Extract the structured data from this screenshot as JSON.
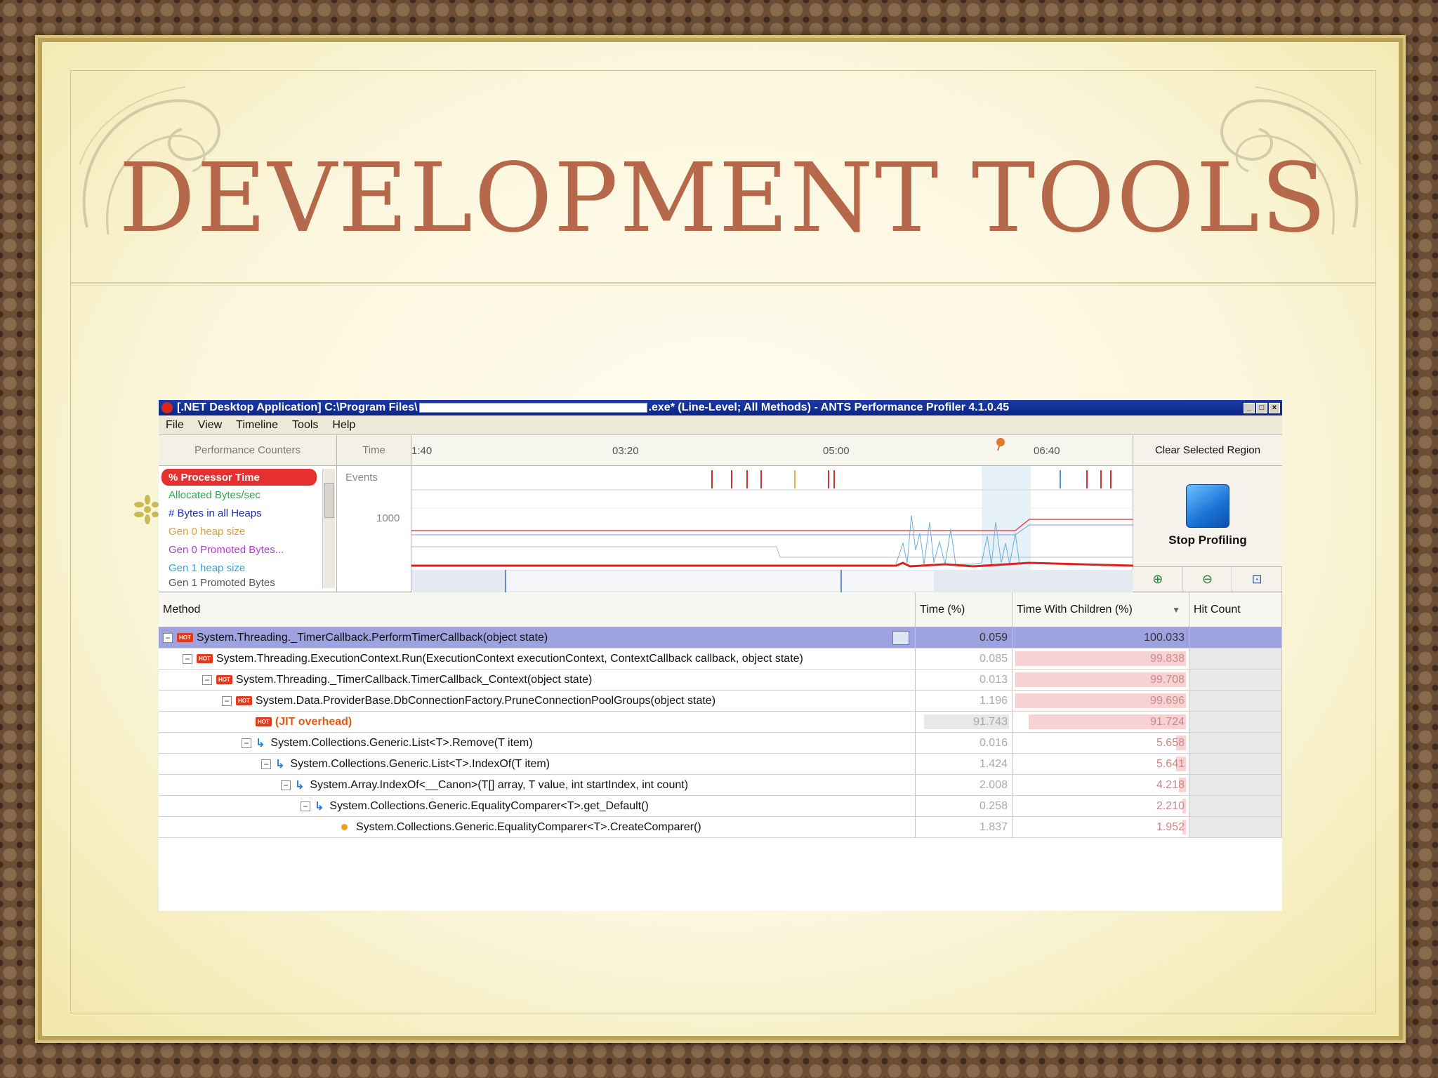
{
  "slide": {
    "title": "DEVELOPMENT TOOLS"
  },
  "window": {
    "title_prefix": "[.NET Desktop Application] C:\\Program Files\\",
    "title_suffix": ".exe* (Line-Level; All Methods) - ANTS Performance Profiler 4.1.0.45"
  },
  "menu": {
    "items": [
      "File",
      "View",
      "Timeline",
      "Tools",
      "Help"
    ]
  },
  "timeline": {
    "performance_counters_label": "Performance Counters",
    "time_label": "Time",
    "events_label": "Events",
    "y_tick": "1000",
    "ticks": [
      "1:40",
      "03:20",
      "05:00",
      "06:40"
    ],
    "clear_region_label": "Clear Selected Region",
    "stop_profiling_label": "Stop Profiling",
    "counters": [
      {
        "label": "% Processor Time",
        "color": "#ffffff"
      },
      {
        "label": "Allocated Bytes/sec",
        "color": "#2aa84a"
      },
      {
        "label": "# Bytes in all Heaps",
        "color": "#1c2fb3"
      },
      {
        "label": "Gen 0 heap size",
        "color": "#e0a030"
      },
      {
        "label": "Gen 0 Promoted Bytes...",
        "color": "#b33ad1"
      },
      {
        "label": "Gen 1 heap size",
        "color": "#30a8d8"
      },
      {
        "label": "Gen 1 Promoted Bytes",
        "color": "#555555"
      }
    ]
  },
  "grid": {
    "headers": {
      "method": "Method",
      "time": "Time (%)",
      "twc": "Time With Children (%)",
      "hits": "Hit Count"
    },
    "rows": [
      {
        "method": "System.Threading._TimerCallback.PerformTimerCallback(object state)",
        "time": "0.059",
        "twc": "100.033",
        "twc_pct": 100,
        "kind": "hot"
      },
      {
        "method": "System.Threading.ExecutionContext.Run(ExecutionContext executionContext, ContextCallback callback, object state)",
        "time": "0.085",
        "twc": "99.838",
        "twc_pct": 99.8,
        "kind": "hot"
      },
      {
        "method": "System.Threading._TimerCallback.TimerCallback_Context(object state)",
        "time": "0.013",
        "twc": "99.708",
        "twc_pct": 99.7,
        "kind": "hot"
      },
      {
        "method": "System.Data.ProviderBase.DbConnectionFactory.PruneConnectionPoolGroups(object state)",
        "time": "1.196",
        "twc": "99.696",
        "twc_pct": 99.7,
        "kind": "hot"
      },
      {
        "method": "(JIT overhead)",
        "time": "91.743",
        "twc": "91.724",
        "twc_pct": 91.7,
        "kind": "jit"
      },
      {
        "method": "System.Collections.Generic.List<T>.Remove(T item)",
        "time": "0.016",
        "twc": "5.658",
        "twc_pct": 5.7,
        "kind": "call"
      },
      {
        "method": "System.Collections.Generic.List<T>.IndexOf(T item)",
        "time": "1.424",
        "twc": "5.641",
        "twc_pct": 5.6,
        "kind": "call"
      },
      {
        "method": "System.Array.IndexOf<__Canon>(T[] array, T value, int startIndex, int count)",
        "time": "2.008",
        "twc": "4.218",
        "twc_pct": 4.2,
        "kind": "call"
      },
      {
        "method": "System.Collections.Generic.EqualityComparer<T>.get_Default()",
        "time": "0.258",
        "twc": "2.210",
        "twc_pct": 2.2,
        "kind": "call"
      },
      {
        "method": "System.Collections.Generic.EqualityComparer<T>.CreateComparer()",
        "time": "1.837",
        "twc": "1.952",
        "twc_pct": 1.95,
        "kind": "leaf"
      }
    ]
  }
}
